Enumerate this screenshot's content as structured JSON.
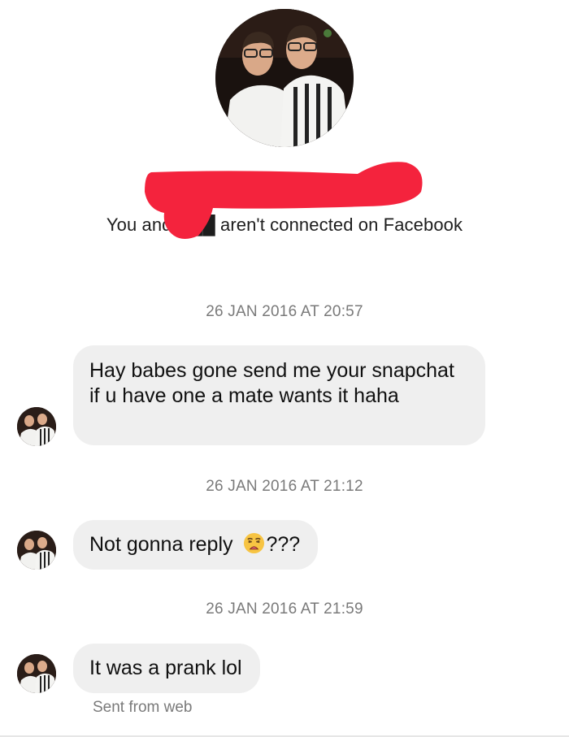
{
  "contact": {
    "photo_alt": "contact-profile-photo",
    "connection_notice": "You and ███ aren't connected on Facebook",
    "redaction_color": "#f4233d"
  },
  "messages": [
    {
      "timestamp": "26 JAN 2016 AT 20:57",
      "text": "Hay babes gone send me your snapchat if u have one a mate wants it haha"
    },
    {
      "timestamp": "26 JAN 2016 AT 21:12",
      "text_before_emoji": "Not gonna reply ",
      "emoji": "weary-face-emoji",
      "text_after_emoji": "???"
    },
    {
      "timestamp": "26 JAN 2016 AT 21:59",
      "text": "It was a prank lol",
      "footer": "Sent from web"
    }
  ],
  "colors": {
    "bubble_bg": "#efefef",
    "meta_text": "#7a7a7a",
    "background": "#ffffff"
  }
}
